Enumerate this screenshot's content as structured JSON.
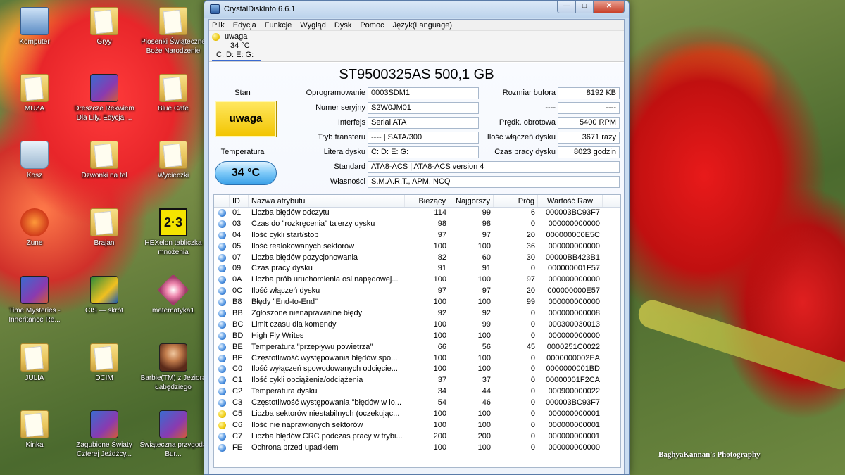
{
  "desktop": {
    "icons": [
      {
        "label": "Komputer"
      },
      {
        "label": "Gryy"
      },
      {
        "label": "Piosenki Świąteczne Boże Narodzenie"
      },
      {
        "label": "MUZA"
      },
      {
        "label": "Dreszcze Rekwiem Dla Lily. Edycja ..."
      },
      {
        "label": "Blue Cafe"
      },
      {
        "label": "Kosz"
      },
      {
        "label": "Dzwonki na tel"
      },
      {
        "label": "Wycieczki"
      },
      {
        "label": "Zune"
      },
      {
        "label": "Brajan"
      },
      {
        "label": "HEXelon tabliczka mnożenia"
      },
      {
        "label": "Time Mysteries - Inheritance Re..."
      },
      {
        "label": "CIS — skrót"
      },
      {
        "label": "matematyka1"
      },
      {
        "label": "JULIA"
      },
      {
        "label": "DCIM"
      },
      {
        "label": "Barbie(TM) z Jeziora Łabędziego"
      },
      {
        "label": "Kinka"
      },
      {
        "label": "Zagubione Światy Czterej Jeźdźcy..."
      },
      {
        "label": "Świąteczna przygoda Bur..."
      }
    ],
    "hex_glyph": "2·3",
    "watermark": "BaghyaKannan's Photography"
  },
  "window": {
    "title": "CrystalDiskInfo 6.6.1",
    "buttons": {
      "minimize": "—",
      "maximize": "□",
      "close": "✕"
    },
    "menu": [
      "Plik",
      "Edycja",
      "Funkcje",
      "Wygląd",
      "Dysk",
      "Pomoc",
      "Język(Language)"
    ],
    "disk_tab": {
      "status": "uwaga",
      "temp": "34 °C",
      "letters": "C: D: E: G:"
    }
  },
  "disk": {
    "model": "ST9500325AS 500,1 GB",
    "stan_label": "Stan",
    "health": "uwaga",
    "temp_label": "Temperatura",
    "temp": "34 °C",
    "fields": {
      "firmware_label": "Oprogramowanie",
      "firmware": "0003SDM1",
      "serial_label": "Numer seryjny",
      "serial": "S2W0JM01",
      "interface_label": "Interfejs",
      "interface": "Serial ATA",
      "transfer_label": "Tryb transferu",
      "transfer": "---- | SATA/300",
      "letters_label": "Litera dysku",
      "letters": "C: D: E: G:",
      "standard_label": "Standard",
      "standard": "ATA8-ACS | ATA8-ACS version 4",
      "features_label": "Własności",
      "features": "S.M.A.R.T., APM, NCQ",
      "buffer_label": "Rozmiar bufora",
      "buffer": "8192 KB",
      "blank_label": "----",
      "blank": "----",
      "rpm_label": "Prędk. obrotowa",
      "rpm": "5400 RPM",
      "power_count_label": "Ilość włączeń dysku",
      "power_count": "3671 razy",
      "power_hours_label": "Czas pracy dysku",
      "power_hours": "8023 godzin"
    }
  },
  "smart": {
    "headers": {
      "id": "ID",
      "name": "Nazwa atrybutu",
      "current": "Bieżący",
      "worst": "Najgorszy",
      "threshold": "Próg",
      "raw": "Wartość Raw"
    },
    "rows": [
      {
        "id": "01",
        "name": "Liczba błędów odczytu",
        "current": "114",
        "worst": "99",
        "threshold": "6",
        "raw": "000003BC93F7",
        "status": "good"
      },
      {
        "id": "03",
        "name": "Czas do \"rozkręcenia\" talerzy dysku",
        "current": "98",
        "worst": "98",
        "threshold": "0",
        "raw": "000000000000",
        "status": "good"
      },
      {
        "id": "04",
        "name": "Ilość cykli start/stop",
        "current": "97",
        "worst": "97",
        "threshold": "20",
        "raw": "000000000E5C",
        "status": "good"
      },
      {
        "id": "05",
        "name": "Ilość realokowanych sektorów",
        "current": "100",
        "worst": "100",
        "threshold": "36",
        "raw": "000000000000",
        "status": "good"
      },
      {
        "id": "07",
        "name": "Liczba błędów pozycjonowania",
        "current": "82",
        "worst": "60",
        "threshold": "30",
        "raw": "00000BB423B1",
        "status": "good"
      },
      {
        "id": "09",
        "name": "Czas pracy dysku",
        "current": "91",
        "worst": "91",
        "threshold": "0",
        "raw": "000000001F57",
        "status": "good"
      },
      {
        "id": "0A",
        "name": "Liczba prób uruchomienia osi napędowej...",
        "current": "100",
        "worst": "100",
        "threshold": "97",
        "raw": "000000000000",
        "status": "good"
      },
      {
        "id": "0C",
        "name": "Ilość włączeń dysku",
        "current": "97",
        "worst": "97",
        "threshold": "20",
        "raw": "000000000E57",
        "status": "good"
      },
      {
        "id": "B8",
        "name": "Błędy \"End-to-End\"",
        "current": "100",
        "worst": "100",
        "threshold": "99",
        "raw": "000000000000",
        "status": "good"
      },
      {
        "id": "BB",
        "name": "Zgłoszone nienaprawialne błędy",
        "current": "92",
        "worst": "92",
        "threshold": "0",
        "raw": "000000000008",
        "status": "good"
      },
      {
        "id": "BC",
        "name": "Limit czasu dla komendy",
        "current": "100",
        "worst": "99",
        "threshold": "0",
        "raw": "000300030013",
        "status": "good"
      },
      {
        "id": "BD",
        "name": "High Fly Writes",
        "current": "100",
        "worst": "100",
        "threshold": "0",
        "raw": "000000000000",
        "status": "good"
      },
      {
        "id": "BE",
        "name": "Temperatura \"przepływu powietrza\"",
        "current": "66",
        "worst": "56",
        "threshold": "45",
        "raw": "0000251C0022",
        "status": "good"
      },
      {
        "id": "BF",
        "name": "Częstotliwość występowania błędów spo...",
        "current": "100",
        "worst": "100",
        "threshold": "0",
        "raw": "0000000002EA",
        "status": "good"
      },
      {
        "id": "C0",
        "name": "Ilość wyłączeń spowodowanych odcięcie...",
        "current": "100",
        "worst": "100",
        "threshold": "0",
        "raw": "0000000001BD",
        "status": "good"
      },
      {
        "id": "C1",
        "name": "Ilość cykli obciążenia/odciążenia",
        "current": "37",
        "worst": "37",
        "threshold": "0",
        "raw": "00000001F2CA",
        "status": "good"
      },
      {
        "id": "C2",
        "name": "Temperatura dysku",
        "current": "34",
        "worst": "44",
        "threshold": "0",
        "raw": "000900000022",
        "status": "good"
      },
      {
        "id": "C3",
        "name": "Częstotliwość występowania \"błędów w lo...",
        "current": "54",
        "worst": "46",
        "threshold": "0",
        "raw": "000003BC93F7",
        "status": "good"
      },
      {
        "id": "C5",
        "name": "Liczba sektorów niestabilnych (oczekując...",
        "current": "100",
        "worst": "100",
        "threshold": "0",
        "raw": "000000000001",
        "status": "warn"
      },
      {
        "id": "C6",
        "name": "Ilość nie naprawionych sektorów",
        "current": "100",
        "worst": "100",
        "threshold": "0",
        "raw": "000000000001",
        "status": "warn"
      },
      {
        "id": "C7",
        "name": "Liczba błędów CRC podczas pracy w trybi...",
        "current": "200",
        "worst": "200",
        "threshold": "0",
        "raw": "000000000001",
        "status": "good"
      },
      {
        "id": "FE",
        "name": "Ochrona przed upadkiem",
        "current": "100",
        "worst": "100",
        "threshold": "0",
        "raw": "000000000000",
        "status": "good"
      }
    ]
  }
}
